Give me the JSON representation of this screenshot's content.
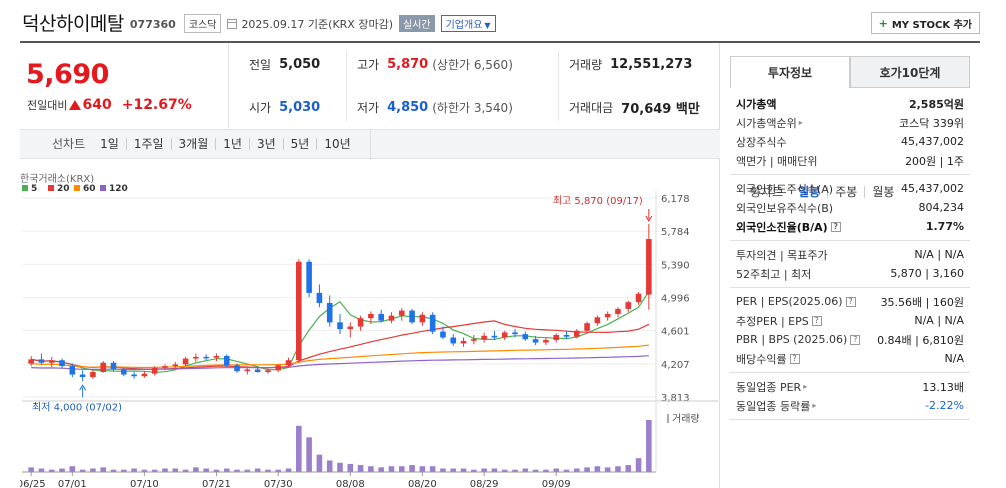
{
  "header": {
    "name": "덕산하이메탈",
    "code": "077360",
    "market": "코스닥",
    "date": "2025.09.17 기준(KRX 장마감)",
    "realtime": "실시간",
    "company_info": "기업개요",
    "mystock": "MY STOCK 추가"
  },
  "price": {
    "current": "5,690",
    "change_label": "전일대비",
    "change": "640",
    "change_pct": "+12.67%"
  },
  "quote": {
    "prev_label": "전일",
    "prev": "5,050",
    "high_label": "고가",
    "high": "5,870",
    "upper": "(상한가 6,560)",
    "volume_label": "거래량",
    "volume": "12,551,273",
    "open_label": "시가",
    "open": "5,030",
    "low_label": "저가",
    "low": "4,850",
    "lower": "(하한가 3,540)",
    "amount_label": "거래대금",
    "amount": "70,649 백만"
  },
  "chart_tabs": {
    "line_label": "선차트",
    "line": [
      "1일",
      "1주일",
      "3개월",
      "1년",
      "3년",
      "5년",
      "10년"
    ],
    "candle_label": "봉차트",
    "candle": [
      "일봉",
      "주봉",
      "월봉"
    ],
    "active_candle": "일봉"
  },
  "chart_data": {
    "type": "candlestick",
    "source": "한국거래소(KRX)",
    "legend": [
      "5",
      "20",
      "60",
      "120"
    ],
    "legend_colors": [
      "#4caf50",
      "#e53935",
      "#fb8c00",
      "#8e63c7"
    ],
    "y_ticks": [
      "6,178",
      "5,784",
      "5,390",
      "4,996",
      "4,601",
      "4,207",
      "3,813"
    ],
    "ylim": [
      3813,
      6178
    ],
    "x_ticks": [
      "06/25",
      "07/01",
      "07/10",
      "07/21",
      "07/30",
      "08/08",
      "08/20",
      "08/29",
      "09/09"
    ],
    "high_annotation": "최고 5,870 (09/17)",
    "low_annotation": "최저 4,000 (07/02)",
    "volume_label": "거래량",
    "candles": [
      [
        4210,
        4300,
        4180,
        4260
      ],
      [
        4260,
        4330,
        4200,
        4220
      ],
      [
        4220,
        4290,
        4170,
        4250
      ],
      [
        4250,
        4270,
        4150,
        4180
      ],
      [
        4180,
        4210,
        4050,
        4080
      ],
      [
        4080,
        4130,
        4000,
        4050
      ],
      [
        4050,
        4140,
        4030,
        4110
      ],
      [
        4110,
        4240,
        4100,
        4220
      ],
      [
        4220,
        4240,
        4120,
        4140
      ],
      [
        4140,
        4160,
        4060,
        4080
      ],
      [
        4080,
        4110,
        4030,
        4060
      ],
      [
        4060,
        4120,
        4040,
        4090
      ],
      [
        4090,
        4180,
        4070,
        4160
      ],
      [
        4160,
        4200,
        4130,
        4180
      ],
      [
        4180,
        4230,
        4150,
        4200
      ],
      [
        4200,
        4290,
        4180,
        4270
      ],
      [
        4270,
        4330,
        4230,
        4290
      ],
      [
        4290,
        4320,
        4250,
        4280
      ],
      [
        4280,
        4330,
        4240,
        4300
      ],
      [
        4300,
        4320,
        4170,
        4190
      ],
      [
        4190,
        4210,
        4100,
        4120
      ],
      [
        4120,
        4160,
        4080,
        4140
      ],
      [
        4140,
        4180,
        4100,
        4110
      ],
      [
        4110,
        4150,
        4090,
        4130
      ],
      [
        4130,
        4200,
        4110,
        4190
      ],
      [
        4190,
        4280,
        4170,
        4250
      ],
      [
        4250,
        5450,
        4220,
        5420
      ],
      [
        5420,
        5450,
        5000,
        5050
      ],
      [
        5050,
        5150,
        4880,
        4930
      ],
      [
        4930,
        5020,
        4650,
        4700
      ],
      [
        4700,
        4800,
        4560,
        4620
      ],
      [
        4620,
        4700,
        4520,
        4650
      ],
      [
        4650,
        4780,
        4600,
        4750
      ],
      [
        4750,
        4830,
        4680,
        4800
      ],
      [
        4800,
        4850,
        4700,
        4720
      ],
      [
        4720,
        4820,
        4690,
        4780
      ],
      [
        4780,
        4870,
        4720,
        4840
      ],
      [
        4840,
        4860,
        4680,
        4700
      ],
      [
        4700,
        4820,
        4660,
        4790
      ],
      [
        4790,
        4820,
        4560,
        4590
      ],
      [
        4590,
        4650,
        4500,
        4520
      ],
      [
        4520,
        4560,
        4420,
        4450
      ],
      [
        4450,
        4520,
        4410,
        4480
      ],
      [
        4480,
        4550,
        4440,
        4500
      ],
      [
        4500,
        4580,
        4460,
        4540
      ],
      [
        4540,
        4600,
        4490,
        4520
      ],
      [
        4520,
        4600,
        4490,
        4580
      ],
      [
        4580,
        4620,
        4520,
        4560
      ],
      [
        4560,
        4590,
        4480,
        4500
      ],
      [
        4500,
        4540,
        4430,
        4460
      ],
      [
        4460,
        4520,
        4430,
        4490
      ],
      [
        4490,
        4570,
        4460,
        4550
      ],
      [
        4550,
        4600,
        4500,
        4530
      ],
      [
        4530,
        4620,
        4510,
        4600
      ],
      [
        4600,
        4710,
        4580,
        4690
      ],
      [
        4690,
        4780,
        4660,
        4760
      ],
      [
        4760,
        4830,
        4720,
        4800
      ],
      [
        4800,
        4880,
        4760,
        4860
      ],
      [
        4860,
        4960,
        4820,
        4940
      ],
      [
        4940,
        5060,
        4910,
        5040
      ],
      [
        5030,
        5870,
        4850,
        5690
      ]
    ],
    "volumes": [
      4,
      3,
      2,
      3,
      5,
      2,
      3,
      4,
      2,
      2,
      3,
      2,
      2,
      3,
      3,
      2,
      4,
      3,
      2,
      3,
      2,
      2,
      3,
      2,
      2,
      3,
      40,
      30,
      15,
      10,
      8,
      7,
      6,
      5,
      4,
      5,
      5,
      6,
      5,
      5,
      3,
      3,
      3,
      2,
      3,
      3,
      2,
      2,
      3,
      2,
      2,
      3,
      2,
      3,
      4,
      5,
      4,
      5,
      6,
      12,
      45
    ]
  },
  "side": {
    "tabs": [
      "투자정보",
      "호가10단계"
    ],
    "block1": [
      {
        "k": "시가총액",
        "v": "2,585억원",
        "bold": true
      },
      {
        "k": "시가총액순위",
        "v": "코스닥 339위",
        "arrow": true
      },
      {
        "k": "상장주식수",
        "v": "45,437,002"
      },
      {
        "k": "액면가 | 매매단위",
        "v": "200원 | 1주"
      }
    ],
    "block2": [
      {
        "k": "외국인한도주식수(A)",
        "v": "45,437,002"
      },
      {
        "k": "외국인보유주식수(B)",
        "v": "804,234"
      },
      {
        "k": "외국인소진율(B/A)",
        "v": "1.77%",
        "bold": true,
        "q": true
      }
    ],
    "block3": [
      {
        "k": "투자의견 | 목표주가",
        "v": "N/A | N/A"
      },
      {
        "k": "52주최고 | 최저",
        "v": "5,870 | 3,160"
      }
    ],
    "block4": [
      {
        "k": "PER | EPS(2025.06)",
        "v": "35.56배 | 160원",
        "q": true
      },
      {
        "k": "추정PER | EPS",
        "v": "N/A | N/A",
        "q": true
      },
      {
        "k": "PBR | BPS (2025.06)",
        "v": "0.84배 | 6,810원",
        "q": true
      },
      {
        "k": "배당수익률",
        "v": "N/A",
        "q": true
      }
    ],
    "block5": [
      {
        "k": "동일업종 PER",
        "v": "13.13배",
        "arrow": true
      },
      {
        "k": "동일업종 등락률",
        "v": "-2.22%",
        "arrow": true,
        "blue": true
      }
    ]
  }
}
